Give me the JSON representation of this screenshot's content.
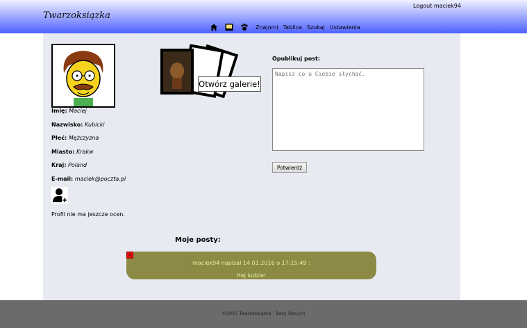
{
  "header": {
    "site_title": "Twarzoksiązka",
    "logout_label": "Logout maciek94",
    "nav": {
      "icons": [
        "home-icon",
        "messages-icon",
        "friends-paw-icon"
      ],
      "items": [
        "Znajomi",
        "Tablica",
        "Szukaj",
        "Ustawienia"
      ]
    },
    "colors": {
      "gradient_top": "#f0f0ff",
      "gradient_bottom": "#4d62ff"
    }
  },
  "profile": {
    "fields": [
      {
        "label": "Imię:",
        "value": "Maciej"
      },
      {
        "label": "Nazwisko:",
        "value": "Kubicki"
      },
      {
        "label": "Płeć:",
        "value": "Mężczyzna"
      },
      {
        "label": "Miasto:",
        "value": "Krakw"
      },
      {
        "label": "Kraj:",
        "value": "Poland"
      },
      {
        "label": "E-mail:",
        "value": "maciek@poczta.pl"
      }
    ],
    "no_ratings": "Profil nie ma jeszcze ocen."
  },
  "gallery": {
    "button_label": "Otwórz galerie!"
  },
  "publish": {
    "label": "Opublikuj post:",
    "placeholder": "Napisz co u Ciebie słychać.",
    "confirm_label": "Potwierdź"
  },
  "posts": {
    "heading": "Moje posty:",
    "items": [
      {
        "meta": "maciek94 napisał 14.01.2016 o 17:15:49 :",
        "body": "Hej ludzie!",
        "delete_label": "x"
      }
    ],
    "card_color": "#8c8a45"
  },
  "footer": {
    "text": "©2015 Twarzoksiązka - Bazy Danych"
  }
}
